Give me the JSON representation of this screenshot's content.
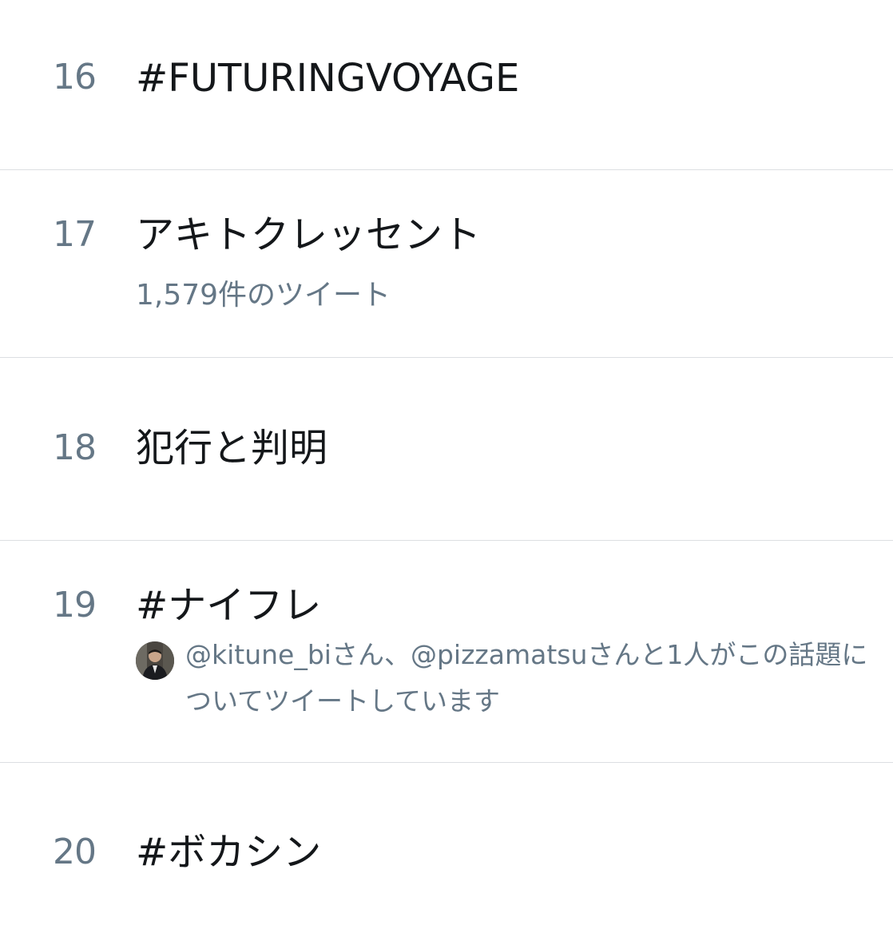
{
  "trends": [
    {
      "rank": "16",
      "topic": "#FUTURINGVOYAGE"
    },
    {
      "rank": "17",
      "topic": "アキトクレッセント",
      "meta": "1,579件のツイート"
    },
    {
      "rank": "18",
      "topic": "犯行と判明"
    },
    {
      "rank": "19",
      "topic": "#ナイフレ",
      "context": "@kitune_biさん、@pizzamatsuさんと1人がこの話題についてツイートしています"
    },
    {
      "rank": "20",
      "topic": "#ボカシン"
    }
  ],
  "colors": {
    "primary_text": "#14171a",
    "secondary_text": "#657786",
    "divider": "#dcdfe2",
    "background": "#ffffff"
  }
}
